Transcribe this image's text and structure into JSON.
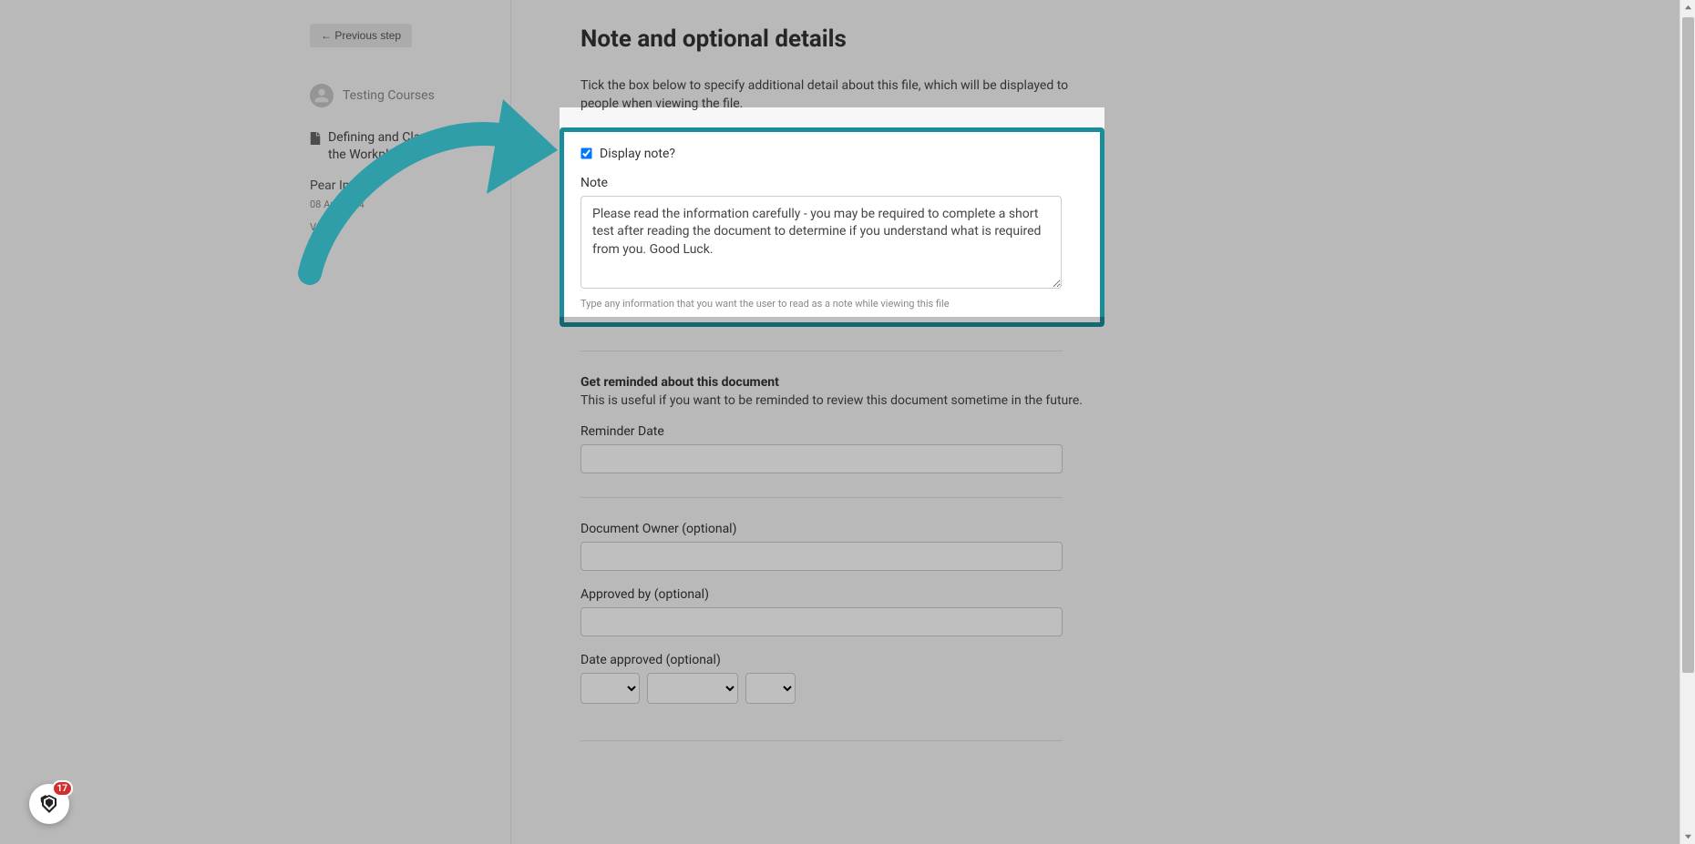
{
  "sidebar": {
    "prev_button": "← Previous step",
    "user_name": "Testing Courses",
    "doc_title": "Defining and Classifying AI in the Workplace",
    "company": "Pear Inc.",
    "date": "08 Apr 2024",
    "version": "V0.1"
  },
  "main": {
    "title": "Note and optional details",
    "intro": "Tick the box below to specify additional detail about this file, which will be displayed to people when viewing the file.",
    "display_note_label": "Display note?",
    "note_label": "Note",
    "note_value": "Please read the information carefully - you may be required to complete a short test after reading the document to determine if you understand what is required from you. Good Luck.",
    "note_helper": "Type any information that you want the user to read as a note while viewing this file",
    "reminder_section_title": "Get reminded about this document",
    "reminder_section_desc": "This is useful if you want to be reminded to review this document sometime in the future.",
    "reminder_date_label": "Reminder Date",
    "doc_owner_label": "Document Owner (optional)",
    "approved_by_label": "Approved by (optional)",
    "date_approved_label": "Date approved (optional)"
  },
  "chat": {
    "badge_count": "17"
  }
}
